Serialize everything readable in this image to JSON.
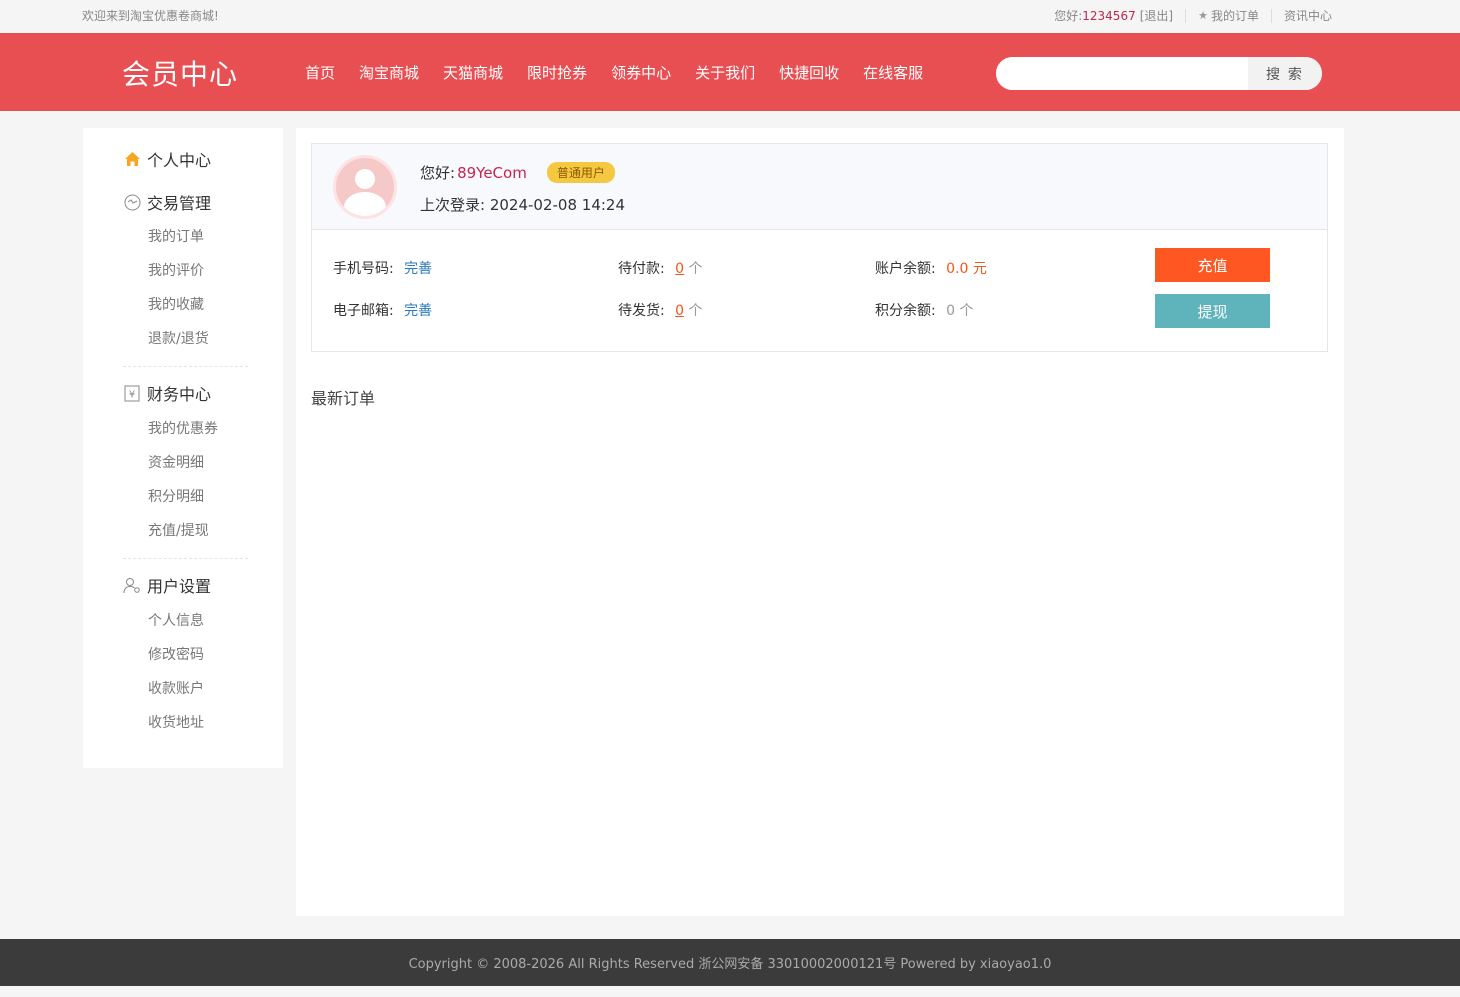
{
  "topbar": {
    "welcome": "欢迎来到淘宝优惠卷商城!",
    "hello_prefix": "您好:",
    "username": "1234567",
    "logout": "[退出]",
    "my_orders": "我的订单",
    "news_center": "资讯中心"
  },
  "header": {
    "logo": "会员中心",
    "nav": [
      "首页",
      "淘宝商城",
      "天猫商城",
      "限时抢券",
      "领券中心",
      "关于我们",
      "快捷回收",
      "在线客服"
    ],
    "search_placeholder": "",
    "search_button": "搜 索"
  },
  "sidebar": {
    "personal_center": "个人中心",
    "groups": [
      {
        "title": "交易管理",
        "icon": "exchange-icon",
        "items": [
          "我的订单",
          "我的评价",
          "我的收藏",
          "退款/退货"
        ]
      },
      {
        "title": "财务中心",
        "icon": "finance-icon",
        "items": [
          "我的优惠券",
          "资金明细",
          "积分明细",
          "充值/提现"
        ]
      },
      {
        "title": "用户设置",
        "icon": "user-settings-icon",
        "items": [
          "个人信息",
          "修改密码",
          "收款账户",
          "收货地址"
        ]
      }
    ]
  },
  "profile": {
    "hello_label": "您好:",
    "nickname": "89YeCom",
    "level_badge": "普通用户",
    "last_login_label": "上次登录:",
    "last_login_time": "2024-02-08 14:24",
    "phone_label": "手机号码:",
    "phone_value": "完善",
    "email_label": "电子邮箱:",
    "email_value": "完善",
    "pending_pay_label": "待付款:",
    "pending_pay_count": "0",
    "pending_ship_label": "待发货:",
    "pending_ship_count": "0",
    "unit_ge": "个",
    "balance_label": "账户余额:",
    "balance_value": "0.0 元",
    "points_label": "积分余额:",
    "points_value": "0 个",
    "recharge_button": "充值",
    "withdraw_button": "提现"
  },
  "latest_orders_title": "最新订单",
  "footer": {
    "text": "Copyright © 2008-2026 All Rights Reserved 浙公网安备 33010002000121号   Powered by xiaoyao1.0"
  },
  "colors": {
    "brand_red": "#e84f52",
    "recharge_orange": "#ff5722",
    "withdraw_teal": "#5fb4bc",
    "badge_yellow": "#f5c842"
  }
}
